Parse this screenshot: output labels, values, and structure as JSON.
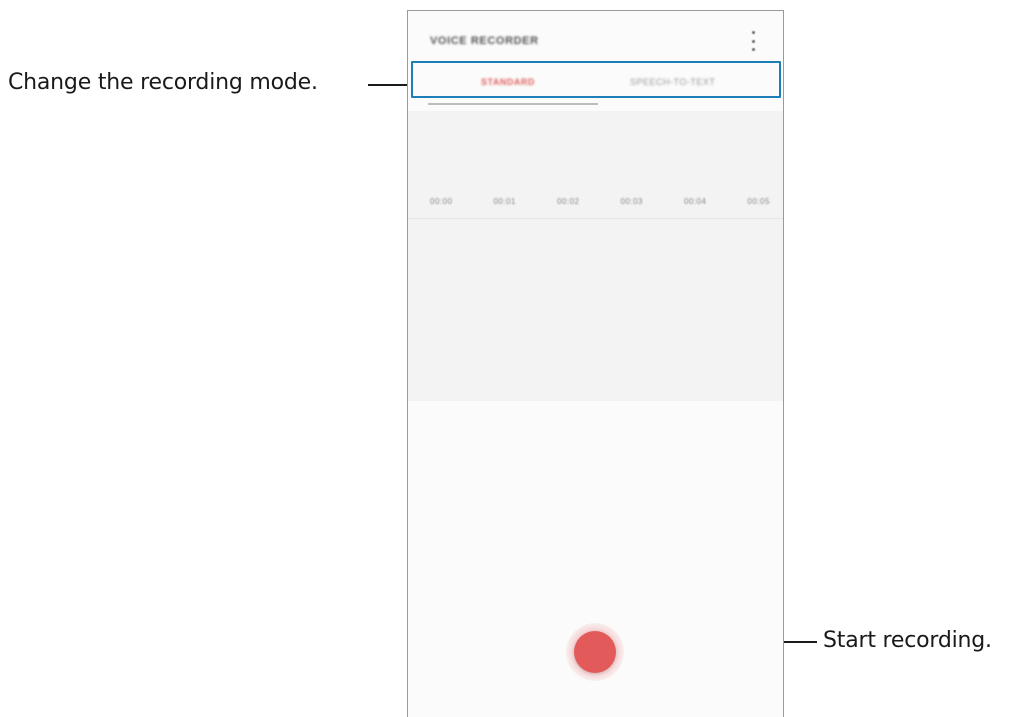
{
  "callouts": {
    "recording_mode": "Change the recording mode.",
    "start_recording": "Start recording."
  },
  "app": {
    "title": "VOICE RECORDER",
    "more_icon": "more-vert-icon"
  },
  "tabs": [
    {
      "label": "STANDARD",
      "selected": true
    },
    {
      "label": "SPEECH-TO-TEXT",
      "selected": false
    }
  ],
  "timeline": [
    "00:00",
    "00:01",
    "00:02",
    "00:03",
    "00:04",
    "00:05"
  ],
  "record_icon": "record-icon",
  "colors": {
    "callout_highlight": "#1c7fb8",
    "accent": "#e25a5a"
  }
}
